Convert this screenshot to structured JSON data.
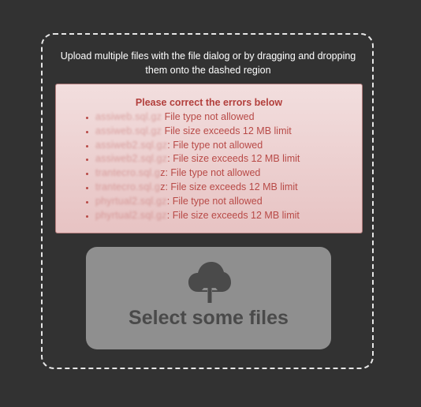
{
  "instructions": "Upload multiple files with the file dialog or by dragging and dropping them onto the dashed region",
  "errors": {
    "title": "Please correct the errors below",
    "items": [
      {
        "filename": "assiweb.sql.gz",
        "message": " File type not allowed"
      },
      {
        "filename": "assiweb.sql.gz",
        "message": " File size exceeds 12 MB limit"
      },
      {
        "filename": "assiweb2.sql.gz",
        "message": ": File type not allowed"
      },
      {
        "filename": "assiweb2.sql.gz",
        "message": ": File size exceeds 12 MB limit"
      },
      {
        "filename": "trantecro.sql.g",
        "message": "z: File type not allowed"
      },
      {
        "filename": "trantecro.sql.g",
        "message": "z: File size exceeds 12 MB limit"
      },
      {
        "filename": "phyrtual2.sql.gz",
        "message": ": File type not allowed"
      },
      {
        "filename": "phyrtual2.sql.gz",
        "message": ": File size exceeds 12 MB limit"
      }
    ]
  },
  "select_button": {
    "label": "Select some files",
    "icon": "cloud-upload-icon"
  },
  "colors": {
    "background": "#323232",
    "dropzone_border": "#e6e6e6",
    "error_bg": "#f2dede",
    "error_text": "#b84a47",
    "button_bg": "#8f8f8f",
    "button_text": "#4a4a4a"
  }
}
